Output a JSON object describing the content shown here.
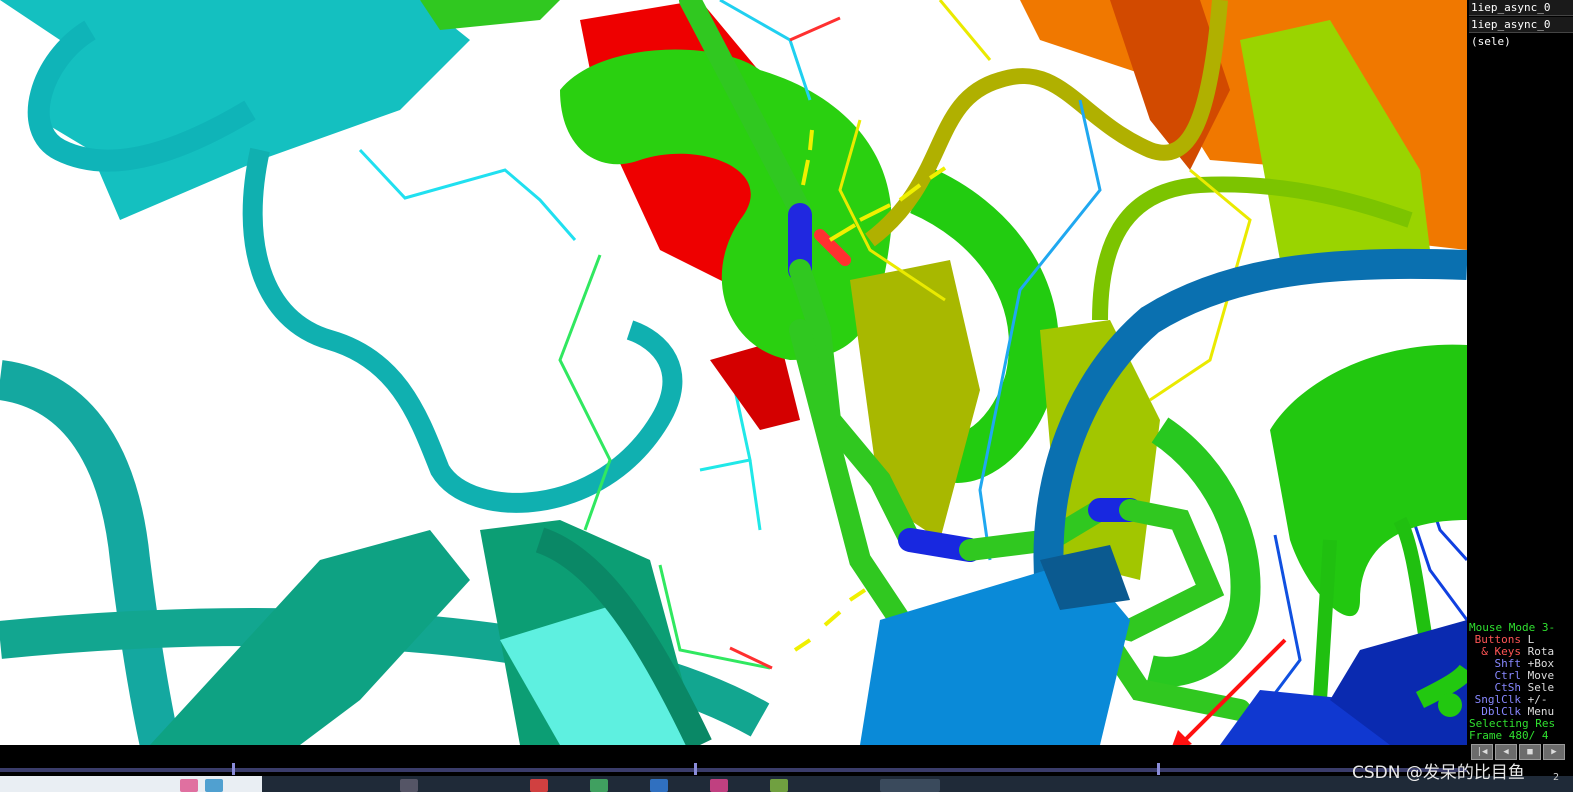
{
  "object_panel": {
    "objects": [
      "1iep_async_0",
      "1iep_async_0",
      "(sele)"
    ]
  },
  "mouse_panel": {
    "title": "Mouse Mode 3-",
    "rows": [
      {
        "key": "Buttons",
        "value": "L",
        "color": "#ff5555"
      },
      {
        "key": "& Keys",
        "value": "Rota",
        "color": "#ff5555"
      },
      {
        "key": "Shft",
        "value": "+Box",
        "color": "#8888ff"
      },
      {
        "key": "Ctrl",
        "value": "Move",
        "color": "#8888ff"
      },
      {
        "key": "CtSh",
        "value": "Sele",
        "color": "#8888ff"
      },
      {
        "key": "SnglClk",
        "value": "+/-",
        "color": "#8888ff"
      },
      {
        "key": "DblClk",
        "value": "Menu",
        "color": "#8888ff"
      }
    ],
    "selecting": "Selecting Res",
    "frame": "Frame  480/ 4"
  },
  "movie_buttons": [
    "|◀",
    "◀",
    "■",
    "▶"
  ],
  "watermark": "CSDN @发呆的比目鱼",
  "clock_fragment": "2",
  "colors": {
    "cyan_chain": "#0fc8c8",
    "teal_chain": "#0a9a78",
    "green_chain": "#22cc10",
    "red_helix": "#ee0000",
    "olive": "#a6b800",
    "blue_loop": "#0a78b8",
    "dark_blue": "#1040c0",
    "orange": "#f07800"
  }
}
